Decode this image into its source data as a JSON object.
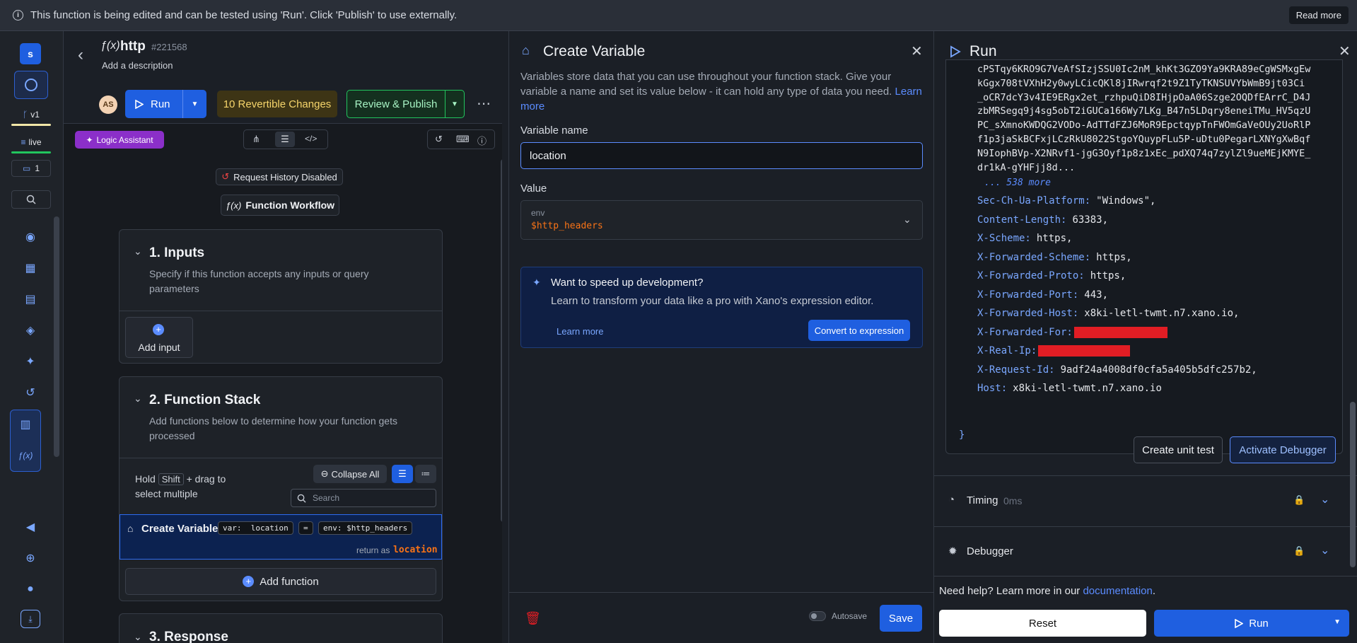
{
  "banner": {
    "message": "This function is being edited and can be tested using 'Run'. Click 'Publish' to use externally.",
    "read_more": "Read more"
  },
  "rail": {
    "avatar_letter": "s",
    "version": "v1",
    "live": "live",
    "comments_count": "1"
  },
  "function": {
    "name": "http",
    "id": "#221568",
    "add_description": "Add a description",
    "user_initials": "AS",
    "run_label": "Run",
    "revertible": "10 Revertible Changes",
    "review_publish": "Review & Publish",
    "logic_assistant": "Logic Assistant",
    "request_history": "Request History Disabled",
    "workflow": "Function Workflow",
    "inputs_title": "1. Inputs",
    "inputs_desc": "Specify if this function accepts any inputs or query parameters",
    "add_input": "Add input",
    "stack_title": "2. Function Stack",
    "stack_desc": "Add functions below to determine how your function gets processed",
    "hold_text_a": "Hold",
    "shift_key": "Shift",
    "hold_text_b": "+ drag to",
    "hold_text_c": "select multiple",
    "collapse_all": "Collapse All",
    "search_placeholder": "Search",
    "step_name": "Create Variable",
    "step_var_prefix": "var:",
    "step_var_name": "location",
    "step_eq": "=",
    "step_env_prefix": "env:",
    "step_env_value": "$http_headers",
    "return_as": "return as",
    "return_var": "location",
    "add_function": "Add function",
    "response_title": "3. Response"
  },
  "create_variable": {
    "title": "Create Variable",
    "description": "Variables store data that you can use throughout your function stack. Give your variable a name and set its value below - it can hold any type of data you need.",
    "learn_more": "Learn more",
    "name_label": "Variable name",
    "name_value": "location",
    "value_label": "Value",
    "value_type": "env",
    "value_value": "$http_headers",
    "tip_title": "Want to speed up development?",
    "tip_desc": "Learn to transform your data like a pro with Xano's expression editor.",
    "tip_learn_more": "Learn more",
    "convert": "Convert to expression",
    "autosave": "Autosave",
    "save": "Save"
  },
  "run": {
    "title": "Run",
    "token_lines": [
      "cPSTqy6KRO9G7VeAfSIzjSSU0Ic2nM_khKt3GZO9Ya9KRA89eCgWSMxgEw",
      "kGgx708tVXhH2y0wyLCicQKl8jIRwrqf2t9Z1TyTKNSUVYbWmB9jt03Ci",
      "_oCR7dcY3v4IE9ERgx2et_rzhpuQiD8IHjpOaA06Szge2OQDfEArrC_D4J",
      "zbMRSegq9j4sg5obT2iGUCa166Wy7LKg_B47n5LDqry8eneiTMu_HV5qzU",
      "PC_sXmnoKWDQG2VODo-AdTTdFZJ6MoR9EpctqypTnFWOmGaVeOUy2UoRlP",
      "f1p3jaSkBCFxjLCzRkU8022StgoYQuypFLu5P-uDtu0PegarLXNYgXwBqf",
      "N9IophBVp-X2NRvf1-jgG3Oyf1p8z1xEc_pdXQ74q7zylZl9ueMEjKMYE_",
      "dr1kA-gYHFjj8d..."
    ],
    "more_text": "... 538 more",
    "headers": [
      {
        "key": "Sec-Ch-Ua-Platform:",
        "value": "\"Windows\","
      },
      {
        "key": "Content-Length:",
        "value": "63383,"
      },
      {
        "key": "X-Scheme:",
        "value": "https,"
      },
      {
        "key": "X-Forwarded-Scheme:",
        "value": "https,"
      },
      {
        "key": "X-Forwarded-Proto:",
        "value": "https,"
      },
      {
        "key": "X-Forwarded-Port:",
        "value": "443,"
      },
      {
        "key": "X-Forwarded-Host:",
        "value": "x8ki-letl-twmt.n7.xano.io,"
      },
      {
        "key": "X-Forwarded-For:",
        "value": ""
      },
      {
        "key": "X-Real-Ip:",
        "value": ""
      },
      {
        "key": "X-Request-Id:",
        "value": "9adf24a4008df0cfa5a405b5dfc257b2,"
      },
      {
        "key": "Host:",
        "value": "x8ki-letl-twmt.n7.xano.io"
      }
    ],
    "closing_brace": "}",
    "create_unit_test": "Create unit test",
    "activate_debugger": "Activate Debugger",
    "timing_label": "Timing",
    "timing_value": "0ms",
    "debugger_label": "Debugger",
    "help_text": "Need help? Learn more in our",
    "help_link": "documentation",
    "help_period": ".",
    "reset": "Reset",
    "run_button": "Run"
  },
  "colors": {
    "accent": "#1f5fe0",
    "banner_bg": "#2a2f38",
    "revertible_bg": "#3d3415",
    "publish_border": "#22c55e",
    "logic_assistant": "#8b2fc9",
    "redaction": "#e11d24",
    "var_orange": "#f97316"
  }
}
